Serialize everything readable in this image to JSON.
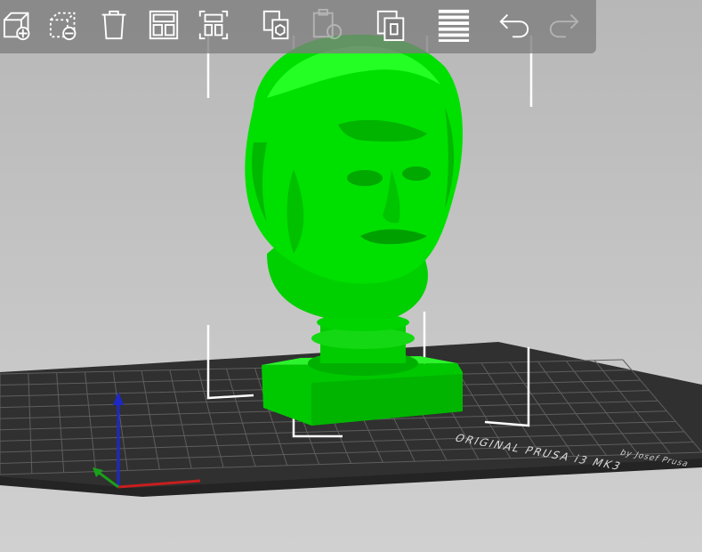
{
  "toolbar": {
    "buttons": [
      {
        "name": "add-button",
        "icon": "cube-plus-icon",
        "enabled": true
      },
      {
        "name": "delete-button",
        "icon": "dashed-cube-minus-icon",
        "enabled": true
      },
      {
        "name": "delete-all-button",
        "icon": "trash-icon",
        "enabled": true
      },
      {
        "name": "arrange-button",
        "icon": "layout-grid-icon",
        "enabled": true
      },
      {
        "name": "arrange-selection-button",
        "icon": "layout-selection-icon",
        "enabled": true
      },
      {
        "name": "copy-button",
        "icon": "copy-icon",
        "enabled": true
      },
      {
        "name": "paste-button",
        "icon": "paste-icon",
        "enabled": false
      },
      {
        "name": "instance-button",
        "icon": "instances-icon",
        "enabled": true
      },
      {
        "name": "split-layers-button",
        "icon": "layers-icon",
        "enabled": true
      },
      {
        "name": "undo-button",
        "icon": "undo-icon",
        "enabled": true
      },
      {
        "name": "redo-button",
        "icon": "redo-icon",
        "enabled": false
      }
    ]
  },
  "bed": {
    "label": "ORIGINAL PRUSA i3 MK3",
    "sublabel": "by Josef Prusa"
  },
  "colors": {
    "model": "#00e000",
    "bed": "#2e2e2e",
    "grid": "#6a6a6a",
    "axis_x": "#c81e1e",
    "axis_y": "#1aa01a",
    "axis_z": "#1e28c8",
    "bounding_box": "#ffffff"
  }
}
